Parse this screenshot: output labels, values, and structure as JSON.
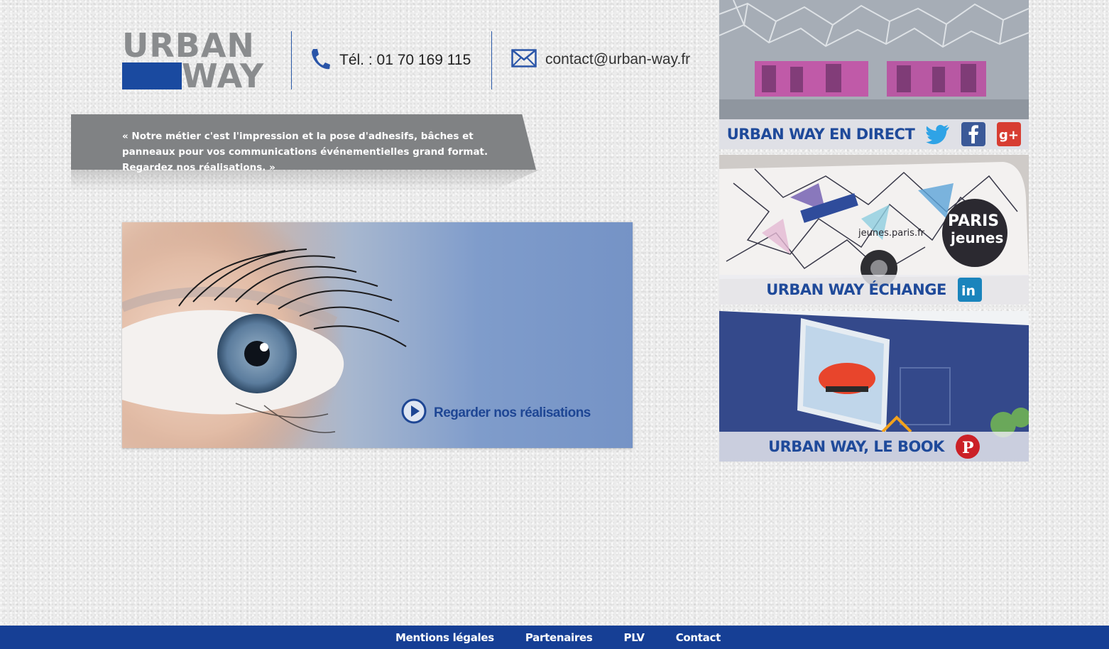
{
  "header": {
    "logo_top": "URBAN",
    "logo_bottom": "WAY",
    "phone": "Tél. : 01 70 169 115",
    "email": "contact@urban-way.fr"
  },
  "banner": {
    "quote": "« Notre métier c'est l'impression et la pose d'adhesifs, bâches et panneaux pour vos communications événementielles grand format. Regardez nos réalisations. »"
  },
  "hero": {
    "cta_label": "Regarder nos réalisations"
  },
  "tiles": [
    {
      "label": "URBAN WAY EN DIRECT",
      "icons": [
        "twitter-icon",
        "facebook-icon",
        "google-plus-icon"
      ]
    },
    {
      "label": "URBAN WAY ÉCHANGE",
      "icons": [
        "linkedin-icon"
      ]
    },
    {
      "label": "URBAN WAY, LE BOOK",
      "icons": [
        "pinterest-icon"
      ]
    }
  ],
  "footer": {
    "links": [
      "Mentions légales",
      "Partenaires",
      "PLV",
      "Contact"
    ]
  },
  "colors": {
    "brand_blue": "#163f95",
    "logo_grey": "#8a8c8e",
    "banner_grey": "#808284"
  }
}
